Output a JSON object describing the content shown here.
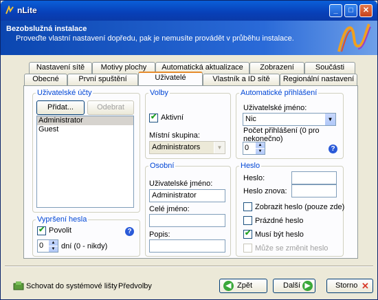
{
  "window": {
    "title": "nLite"
  },
  "header": {
    "title": "Bezobslužná instalace",
    "subtitle": "Proveďte vlastní nastavení dopředu, pak je nemusíte provádět v průběhu instalace."
  },
  "tabs": {
    "row1": [
      "Nastavení sítě",
      "Motivy plochy",
      "Automatická aktualizace",
      "Zobrazení",
      "Součásti"
    ],
    "row2": [
      "Obecné",
      "První spuštění",
      "Uživatelé",
      "Vlastník a ID sítě",
      "Regionální nastavení"
    ]
  },
  "user_accounts": {
    "legend": "Uživatelské účty",
    "add_label": "Přidat...",
    "remove_label": "Odebrat",
    "users": [
      "Administrator",
      "Guest"
    ]
  },
  "expiry": {
    "legend": "Vypršení hesla",
    "enable_label": "Povolit",
    "enable_checked": true,
    "days_value": "0",
    "days_label": "dní (0 - nikdy)"
  },
  "groups": {
    "legend": "Volby",
    "active_label": "Aktivní",
    "active_checked": true,
    "local_group_label": "Místní skupina:",
    "local_group_value": "Administrators"
  },
  "personal": {
    "legend": "Osobní",
    "username_label": "Uživatelské jméno:",
    "username_value": "Administrator",
    "fullname_label": "Celé jméno:",
    "fullname_value": "",
    "desc_label": "Popis:",
    "desc_value": ""
  },
  "autologon": {
    "legend": "Automatické přihlášení",
    "username_label": "Uživatelské jméno:",
    "username_value": "Nic",
    "count_label_1": "Počet přihlášení (0 pro",
    "count_label_2": "nekonečno)",
    "count_value": "0"
  },
  "password": {
    "legend": "Heslo",
    "pwd_label": "Heslo:",
    "pwd_again_label": "Heslo znova:",
    "show_label": "Zobrazit heslo (pouze zde)",
    "empty_label": "Prázdné heslo",
    "must_label": "Musí být heslo",
    "change_label": "Může se změnit heslo",
    "show_checked": false,
    "empty_checked": false,
    "must_checked": true,
    "change_checked": false
  },
  "footer": {
    "hide_label": "Schovat do systémové lišty",
    "prefs_label": "Předvolby",
    "back_label": "Zpět",
    "next_label": "Další",
    "cancel_label": "Storno"
  },
  "colors": {
    "legend": "#0046d5",
    "title_bar": "#0a5fd8"
  },
  "icons": {
    "back": "left-arrow-icon",
    "next": "right-arrow-icon",
    "cancel": "x-icon",
    "help": "question-icon",
    "tray": "tray-icon"
  }
}
